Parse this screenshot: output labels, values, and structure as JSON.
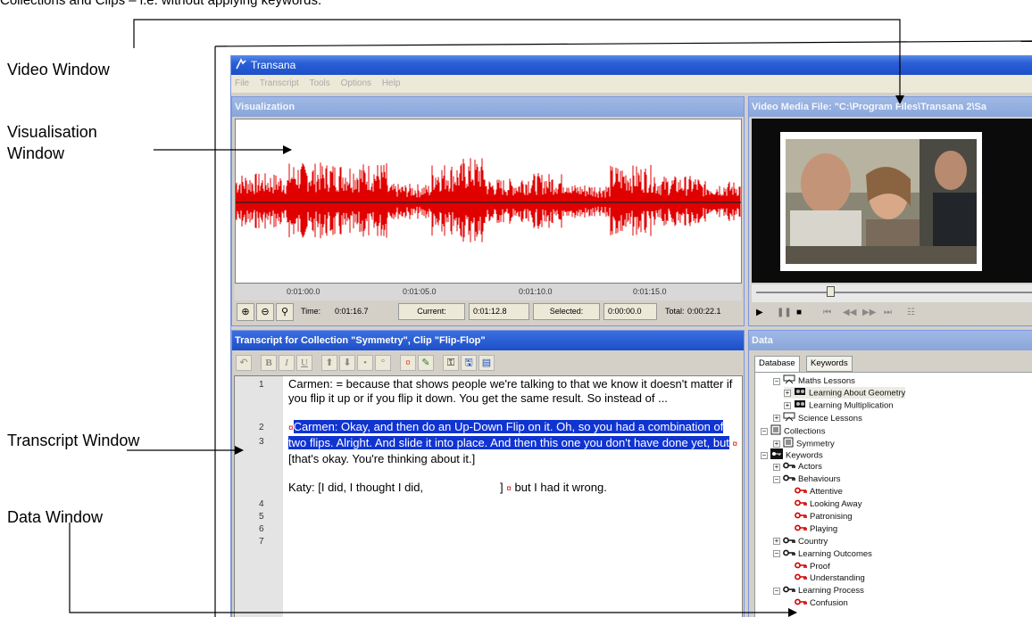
{
  "caption_top": "Collections and Clips – i.e. without applying keywords.",
  "callouts": {
    "video": "Video Window",
    "visualisation_line1": "Visualisation",
    "visualisation_line2": "Window",
    "transcript": "Transcript Window",
    "data": "Data Window"
  },
  "app": {
    "title": "Transana",
    "menu": [
      "File",
      "Transcript",
      "Tools",
      "Options",
      "Help"
    ]
  },
  "visualization": {
    "title": "Visualization",
    "ticks": [
      "0:01:00.0",
      "0:01:05.0",
      "0:01:10.0",
      "0:01:15.0"
    ],
    "time_label": "Time:",
    "time_value": "0:01:16.7",
    "current_label": "Current:",
    "current_value": "0:01:12.8",
    "selected_label": "Selected:",
    "selected_value": "0:00:00.0",
    "total_label": "Total:",
    "total_value": "0:00:22.1",
    "wave_color": "#e00000"
  },
  "video": {
    "title": "Video Media File: \"C:\\Program Files\\Transana 2\\Sa"
  },
  "transcript": {
    "title": "Transcript for Collection \"Symmetry\", Clip \"Flip-Flop\"",
    "line_numbers": [
      "1",
      "2",
      "3",
      "4",
      "5",
      "6",
      "7"
    ],
    "l1": "Carmen:  = because that shows people we're talking to that we know it doesn't matter if you flip it up or if you flip it down.  You get the same result.  So instead of ...",
    "l3_highlight": "Carmen:  Okay, and then do an Up-Down Flip on it.  Oh, so you had a combination of two flips.  Alright.  And slide it into place.  And then this one you don't have done yet, but",
    "l3_rest": "[that's okay.  You're thinking about it.]",
    "l5_a": "Katy:  [I did, I thought I did,",
    "l5_b": "]",
    "l5_c": "but I had it wrong.",
    "marker": "¤",
    "highlight_color": "#1034d0"
  },
  "data_pane": {
    "title": "Data",
    "tabs": [
      "Database",
      "Keywords"
    ],
    "tree": [
      {
        "label": "Maths Lessons",
        "icon": "series-icon",
        "exp": "−"
      },
      {
        "label": "Learning About Geometry",
        "icon": "episode-icon",
        "exp": "+"
      },
      {
        "label": "Learning Multiplication",
        "icon": "episode-icon",
        "exp": "+"
      },
      {
        "label": "Science Lessons",
        "icon": "series-icon",
        "exp": "+"
      },
      {
        "label": "Collections",
        "icon": "collections-icon",
        "exp": "−"
      },
      {
        "label": "Symmetry",
        "icon": "collection-icon",
        "exp": "+"
      },
      {
        "label": "Keywords",
        "icon": "keywords-root-icon",
        "exp": "−"
      },
      {
        "label": "Actors",
        "icon": "key-icon",
        "exp": "+"
      },
      {
        "label": "Behaviours",
        "icon": "key-icon",
        "exp": "−"
      },
      {
        "label": "Attentive",
        "icon": "red-key-icon",
        "exp": ""
      },
      {
        "label": "Looking Away",
        "icon": "red-key-icon",
        "exp": ""
      },
      {
        "label": "Patronising",
        "icon": "red-key-icon",
        "exp": ""
      },
      {
        "label": "Playing",
        "icon": "red-key-icon",
        "exp": ""
      },
      {
        "label": "Country",
        "icon": "key-icon",
        "exp": "+"
      },
      {
        "label": "Learning Outcomes",
        "icon": "key-icon",
        "exp": "−"
      },
      {
        "label": "Proof",
        "icon": "red-key-icon",
        "exp": ""
      },
      {
        "label": "Understanding",
        "icon": "red-key-icon",
        "exp": ""
      },
      {
        "label": "Learning Process",
        "icon": "key-icon",
        "exp": "−"
      },
      {
        "label": "Confusion",
        "icon": "red-key-icon",
        "exp": ""
      }
    ]
  }
}
